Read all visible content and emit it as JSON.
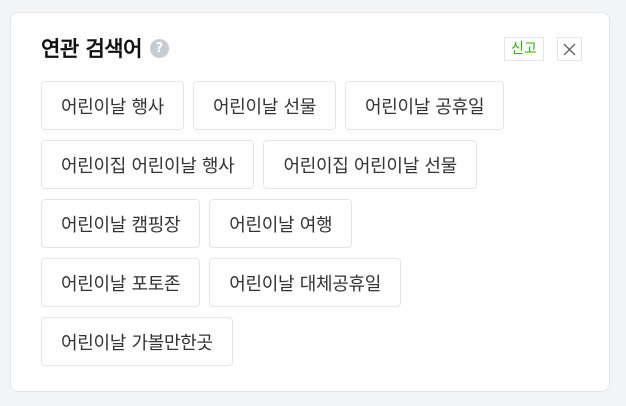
{
  "panel": {
    "title": "연관 검색어",
    "help_icon": "?",
    "report_label": "신고",
    "close_icon": "close-icon"
  },
  "keywords": [
    [
      "어린이날 행사",
      "어린이날 선물",
      "어린이날 공휴일"
    ],
    [
      "어린이집 어린이날 행사",
      "어린이집 어린이날 선물"
    ],
    [
      "어린이날 캠핑장",
      "어린이날 여행"
    ],
    [
      "어린이날 포토존",
      "어린이날 대체공휴일"
    ],
    [
      "어린이날 가볼만한곳"
    ]
  ],
  "colors": {
    "report_text": "#2db400",
    "chip_border": "#e3e5e8",
    "help_icon_bg": "#c8cbd0"
  }
}
